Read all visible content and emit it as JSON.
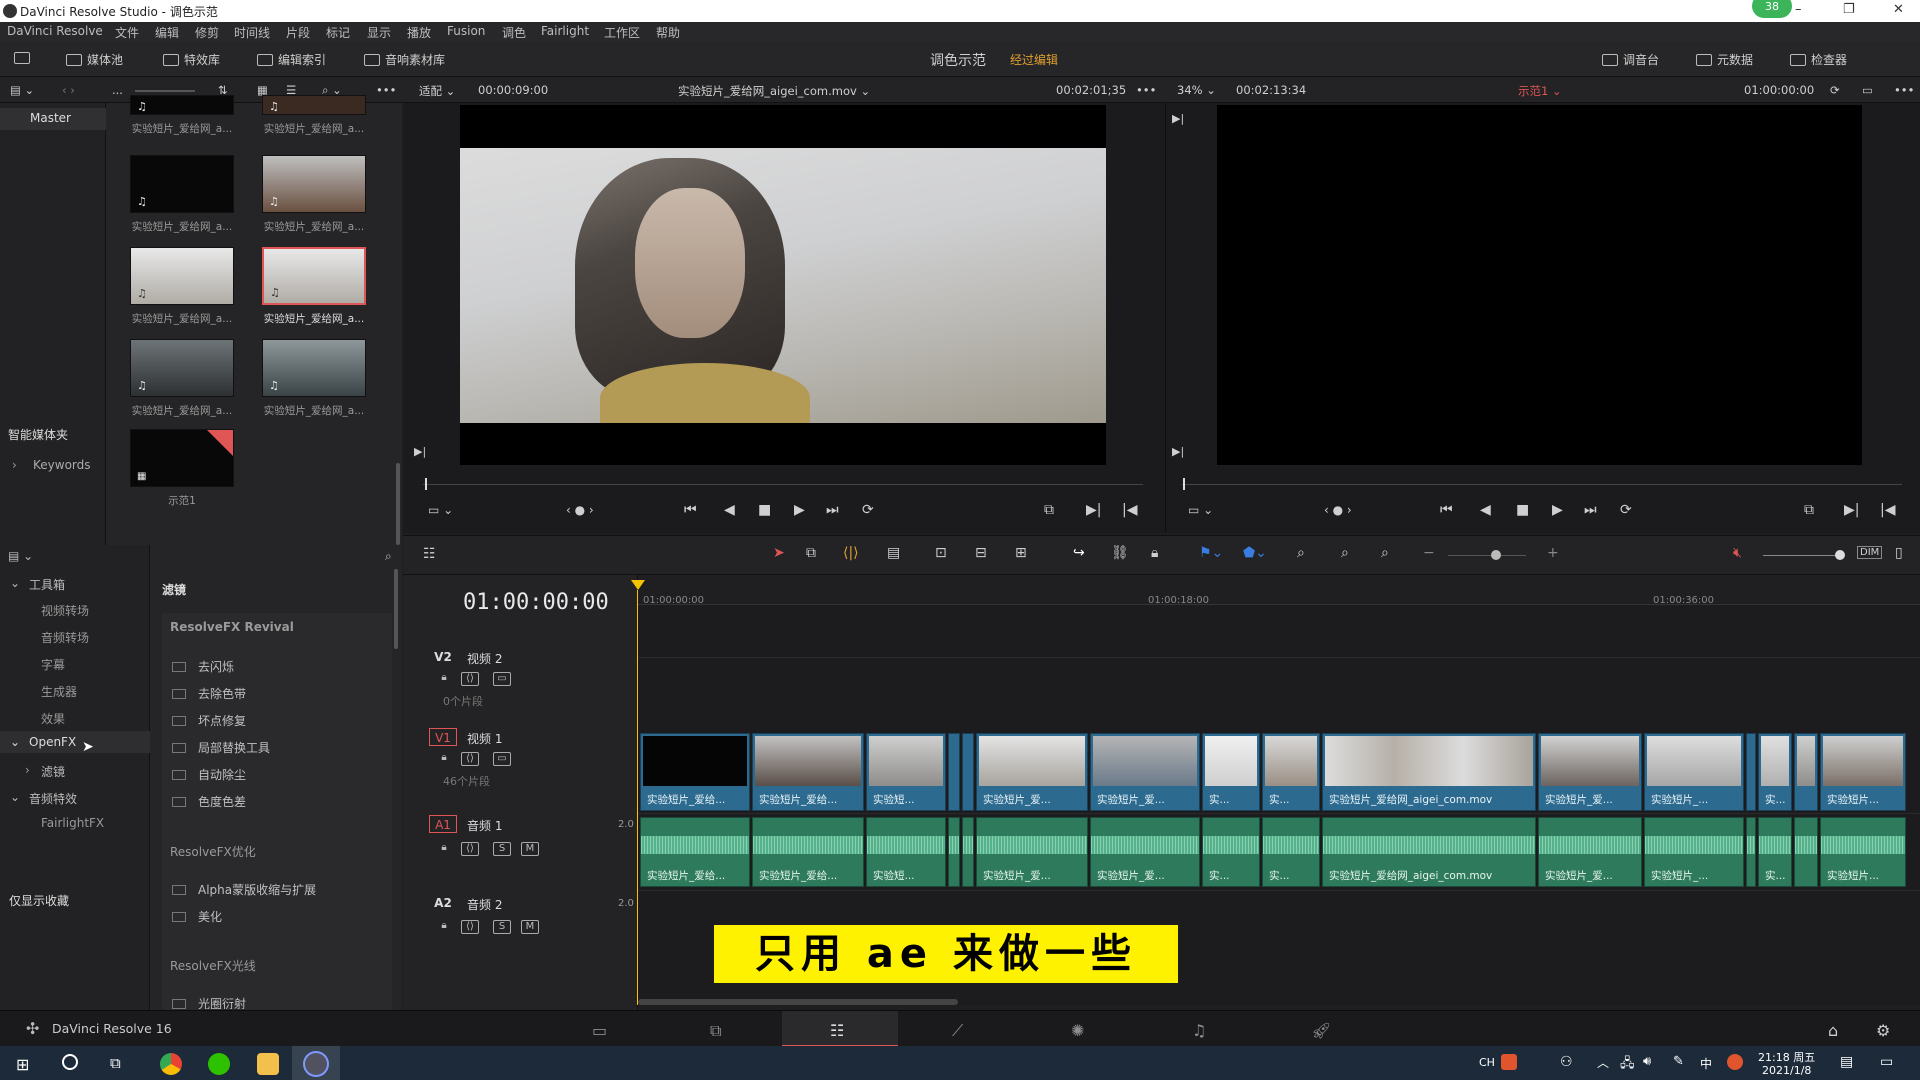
{
  "window": {
    "title": "DaVinci Resolve Studio - 调色示范",
    "badge": "38",
    "min": "–",
    "max": "❐",
    "close": "✕"
  },
  "menu": [
    "DaVinci Resolve",
    "文件",
    "编辑",
    "修剪",
    "时间线",
    "片段",
    "标记",
    "显示",
    "播放",
    "Fusion",
    "调色",
    "Fairlight",
    "工作区",
    "帮助"
  ],
  "toolbar": {
    "media_pool": "媒体池",
    "effects": "特效库",
    "edit_index": "编辑索引",
    "sound_library": "音响素材库",
    "project": "调色示范",
    "status": "经过编辑",
    "mixer": "调音台",
    "metadata": "元数据",
    "inspector": "检查器"
  },
  "subbar": {
    "more": "...",
    "fit": "适配",
    "src_tc": "00:00:09:00",
    "source_clip": "实验短片_爱给网_aigei_com.mov",
    "src_dur": "00:02:01;35",
    "zoom": "34%",
    "rec_tc": "00:02:13:34",
    "timeline_name": "示范1",
    "tl_tc": "01:00:00:00"
  },
  "bins": {
    "master": "Master",
    "smart": "智能媒体夹",
    "keywords": "Keywords"
  },
  "clips": [
    {
      "caption": "实验短片_爱给网_a..."
    },
    {
      "caption": "实验短片_爱给网_a..."
    },
    {
      "caption": "实验短片_爱给网_a..."
    },
    {
      "caption": "实验短片_爱给网_a..."
    },
    {
      "caption": "实验短片_爱给网_a..."
    },
    {
      "caption": "实验短片_爱给网_a..."
    },
    {
      "caption": "实验短片_爱给网_a..."
    },
    {
      "caption": "实验短片_爱给网_a..."
    },
    {
      "caption": "示范1"
    }
  ],
  "effects_nav": {
    "toolbox": "工具箱",
    "video_transitions": "视频转场",
    "audio_transitions": "音频转场",
    "titles": "字幕",
    "generators": "生成器",
    "effects": "效果",
    "openfx": "OpenFX",
    "filters": "滤镜",
    "audio_fx": "音频特效",
    "fairlight_fx": "FairlightFX",
    "favorites": "仅显示收藏"
  },
  "effects_list": {
    "header": "滤镜",
    "group1": "ResolveFX Revival",
    "items1": [
      "去闪烁",
      "去除色带",
      "坏点修复",
      "局部替换工具",
      "自动除尘",
      "色度色差"
    ],
    "group2": "ResolveFX优化",
    "items2": [
      "Alpha蒙版收缩与扩展",
      "美化"
    ],
    "group3": "ResolveFX光线",
    "items3": [
      "光圈衍射"
    ]
  },
  "timeline": {
    "timecode": "01:00:00:00",
    "ruler": [
      "01:00:00:00",
      "01:00:18:00",
      "01:00:36:00"
    ],
    "v2": {
      "id": "V2",
      "name": "视频 2",
      "count": "0个片段"
    },
    "v1": {
      "id": "V1",
      "name": "视频 1",
      "count": "46个片段"
    },
    "a1": {
      "id": "A1",
      "name": "音频 1",
      "level": "2.0",
      "solo": "S",
      "mute": "M"
    },
    "a2": {
      "id": "A2",
      "name": "音频 2",
      "level": "2.0",
      "solo": "S",
      "mute": "M"
    },
    "clip_labels": [
      "实验短片_爱给...",
      "实验短片_爱给...",
      "实验短...",
      "实验短片_爱...",
      "实验短片_爱...",
      "实...",
      "实...",
      "实验短片_爱给网_aigei_com.mov",
      "实验短片_爱...",
      "实验短片_...",
      "实...",
      "实验短片..."
    ]
  },
  "subtitle": "只用 ae 来做一些",
  "app_name": "DaVinci Resolve 16",
  "tray": {
    "ime": "CH",
    "lang": "中",
    "time": "21:18 周五",
    "date": "2021/1/8"
  },
  "colors": {
    "accent": "#e0a030",
    "playhead": "#f5c400",
    "video_clip": "#2c6b8f",
    "audio_clip": "#2d7a5c",
    "selected": "#e05555"
  }
}
